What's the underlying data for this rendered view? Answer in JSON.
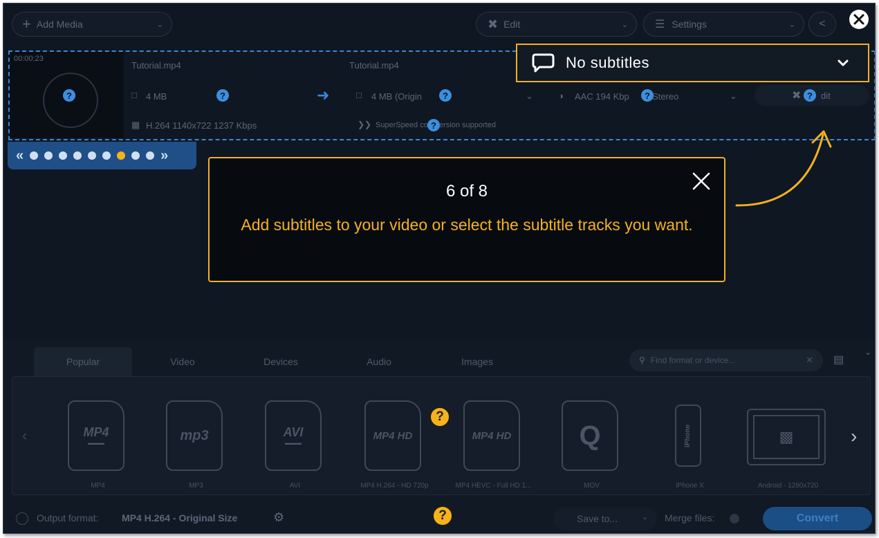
{
  "toolbar": {
    "add_media": "Add Media",
    "edit": "Edit",
    "settings": "Settings"
  },
  "file": {
    "duration": "00:00:23",
    "source_name": "Tutorial.mp4",
    "source_size": "4 MB",
    "video_info": "H.264 1140x722 1237 Kbps",
    "output_name": "Tutorial.mp4",
    "output_size": "4 MB (Origin",
    "audio": "AAC 194 Kbp",
    "audio_channels": "Stereo",
    "superspeed": "SuperSpeed co",
    "superspeed_tail": "ersion supported",
    "edit_button": "dit"
  },
  "subtitles": {
    "selected": "No subtitles"
  },
  "tour": {
    "step": "6 of 8",
    "message": "Add subtitles to your video or select the subtitle tracks you want.",
    "current_index": 6,
    "total_dots": 9
  },
  "format_tabs": [
    "Popular",
    "Video",
    "Devices",
    "Audio",
    "Images"
  ],
  "search": {
    "placeholder": "Find format or device..."
  },
  "formats": [
    {
      "icon": "MP4",
      "label": "MP4"
    },
    {
      "icon": "mp3",
      "label": "MP3"
    },
    {
      "icon": "AVI",
      "label": "AVI"
    },
    {
      "icon": "MP4 HD",
      "label": "MP4 H.264 - HD 720p"
    },
    {
      "icon": "MP4 HD",
      "label": "MP4 HEVC - Full HD 1..."
    },
    {
      "icon": "Q",
      "label": "MOV"
    },
    {
      "icon": "iPhone",
      "label": "iPhone X"
    },
    {
      "icon": "android",
      "label": "Android - 1280x720"
    }
  ],
  "bottom_bar": {
    "output_label": "Output format:",
    "output_value": "MP4 H.264 - Original Size",
    "save_to": "Save to...",
    "merge_files": "Merge files:",
    "convert": "Convert"
  },
  "colors": {
    "accent_yellow": "#f5b21d",
    "accent_blue": "#3a87d6",
    "background": "#0f1722"
  }
}
